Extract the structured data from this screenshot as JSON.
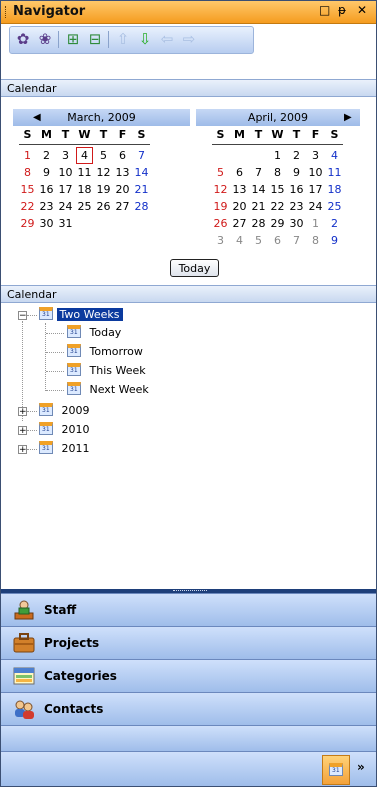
{
  "window": {
    "title": "Navigator",
    "controls": [
      "□",
      "ᵽ",
      "✕"
    ]
  },
  "toolbar": {
    "icons": [
      "new-calendar-icon",
      "edit-calendar-icon",
      "import-icon",
      "export-icon",
      "move-up-icon",
      "move-down-icon",
      "move-left-icon",
      "move-right-icon"
    ]
  },
  "calendar_panel": {
    "header": "Calendar",
    "months": [
      {
        "title": "March, 2009",
        "dow": [
          "S",
          "M",
          "T",
          "W",
          "T",
          "F",
          "S"
        ],
        "rows": [
          [
            "1",
            "2",
            "3",
            "4",
            "5",
            "6",
            "7"
          ],
          [
            "8",
            "9",
            "10",
            "11",
            "12",
            "13",
            "14"
          ],
          [
            "15",
            "16",
            "17",
            "18",
            "19",
            "20",
            "21"
          ],
          [
            "22",
            "23",
            "24",
            "25",
            "26",
            "27",
            "28"
          ],
          [
            "29",
            "30",
            "31",
            "",
            "",
            "",
            ""
          ]
        ]
      },
      {
        "title": "April, 2009",
        "dow": [
          "S",
          "M",
          "T",
          "W",
          "T",
          "F",
          "S"
        ],
        "rows": [
          [
            "",
            "",
            "",
            "1",
            "2",
            "3",
            "4"
          ],
          [
            "5",
            "6",
            "7",
            "8",
            "9",
            "10",
            "11"
          ],
          [
            "12",
            "13",
            "14",
            "15",
            "16",
            "17",
            "18"
          ],
          [
            "19",
            "20",
            "21",
            "22",
            "23",
            "24",
            "25"
          ],
          [
            "26",
            "27",
            "28",
            "29",
            "30",
            "1",
            "2"
          ],
          [
            "3",
            "4",
            "5",
            "6",
            "7",
            "8",
            "9"
          ]
        ]
      }
    ],
    "today_button": "Today",
    "today_date": "4"
  },
  "tree_panel": {
    "header": "Calendar",
    "root": "Two Weeks",
    "children": [
      "Today",
      "Tomorrow",
      "This Week",
      "Next Week"
    ],
    "years": [
      "2009",
      "2010",
      "2011"
    ]
  },
  "nav_buttons": [
    {
      "label": "Staff",
      "icon": "staff-icon"
    },
    {
      "label": "Projects",
      "icon": "briefcase-icon"
    },
    {
      "label": "Categories",
      "icon": "categories-icon"
    },
    {
      "label": "Contacts",
      "icon": "contacts-icon"
    }
  ],
  "colors": {
    "accent": "#f59c1f",
    "selection": "#0b3a9e",
    "weekend_sun": "#d01a1a",
    "weekend_sat": "#1330c9"
  }
}
